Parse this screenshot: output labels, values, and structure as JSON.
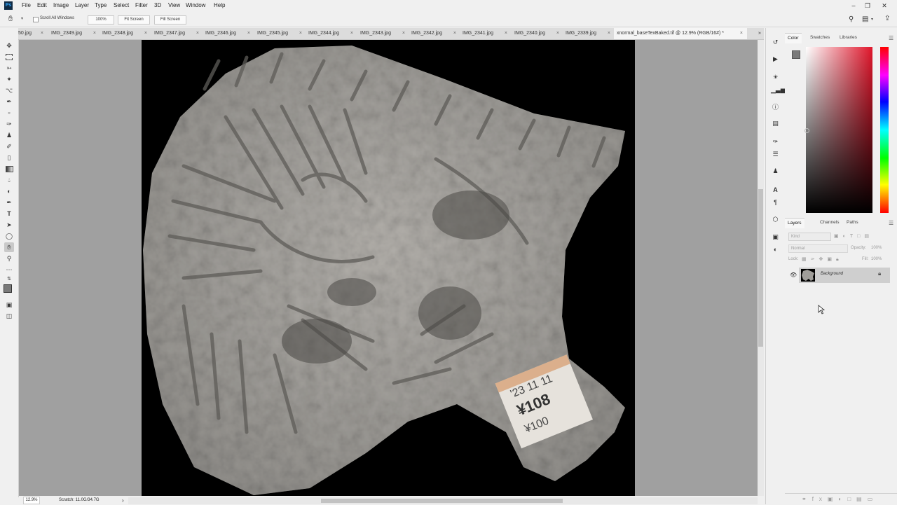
{
  "app": {
    "logo_text": "Ps"
  },
  "menu": [
    "File",
    "Edit",
    "Image",
    "Layer",
    "Type",
    "Select",
    "Filter",
    "3D",
    "View",
    "Window",
    "Help"
  ],
  "window_controls": [
    "–",
    "❐",
    "✕"
  ],
  "options_bar": {
    "scroll_all_windows": "Scroll All Windows",
    "zoom_button": "100%",
    "fit_screen": "Fit Screen",
    "fill_screen": "Fill Screen"
  },
  "tabs": [
    "50.jpg",
    "IMG_2349.jpg",
    "IMG_2348.jpg",
    "IMG_2347.jpg",
    "IMG_2346.jpg",
    "IMG_2345.jpg",
    "IMG_2344.jpg",
    "IMG_2343.jpg",
    "IMG_2342.jpg",
    "IMG_2341.jpg",
    "IMG_2340.jpg",
    "IMG_2339.jpg",
    "xnormal_baseTexBaked.tif @ 12.9% (RGB/16#) *"
  ],
  "tab_close": "×",
  "tab_overflow": "»",
  "status": {
    "zoom": "12.9%",
    "scratch": "Scratch: 11.0G/34.7G",
    "arrow": "›"
  },
  "color_panel": {
    "tabs": [
      "Color",
      "Swatches",
      "Libraries"
    ]
  },
  "layers_panel": {
    "tabs": [
      "Layers",
      "Channels",
      "Paths"
    ],
    "kind_placeholder": "Kind",
    "blend_mode": "Normal",
    "opacity_label": "Opacity:",
    "opacity_value": "100%",
    "lock_label": "Lock:",
    "fill_label": "Fill:",
    "fill_value": "100%",
    "layers": [
      {
        "name": "Background",
        "visible": true,
        "locked": true
      }
    ]
  },
  "sticker": {
    "line1": "'23 11 11",
    "line2": "¥108",
    "line3": "¥100"
  },
  "colors": {
    "accent": "#0f2a44",
    "canvas_bg": "#a0a0a0",
    "document_bg": "#000000",
    "stone": "#9e9c98"
  }
}
